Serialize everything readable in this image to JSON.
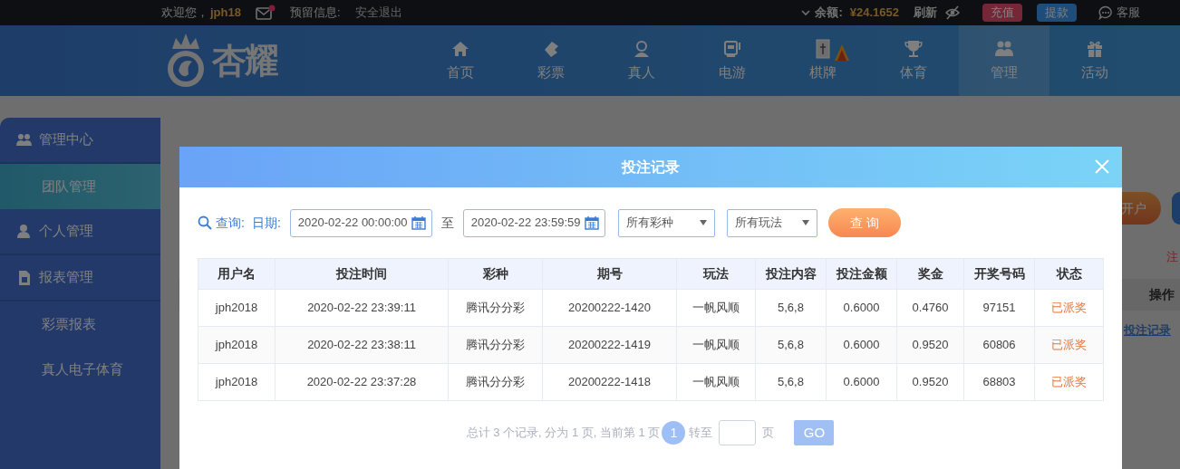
{
  "top_bar": {
    "greeting": "欢迎您，",
    "username": "jph18",
    "mail_unread": true,
    "reserved_info_label": "预留信息:",
    "logout": "安全退出",
    "balance_label": "余额:",
    "balance": "¥24.1652",
    "refresh": "刷新",
    "deposit": "充值",
    "withdraw": "提款",
    "support": "客服"
  },
  "logo": {
    "text": "杏耀"
  },
  "nav": [
    {
      "label": "首页",
      "selected": false,
      "hot": false
    },
    {
      "label": "彩票",
      "selected": false,
      "hot": false
    },
    {
      "label": "真人",
      "selected": false,
      "hot": false
    },
    {
      "label": "电游",
      "selected": false,
      "hot": false
    },
    {
      "label": "棋牌",
      "selected": false,
      "hot": true
    },
    {
      "label": "体育",
      "selected": false,
      "hot": false
    },
    {
      "label": "管理",
      "selected": true,
      "hot": false
    },
    {
      "label": "活动",
      "selected": false,
      "hot": false
    }
  ],
  "sidebar": [
    {
      "label": "管理中心",
      "children": [
        {
          "label": "团队管理",
          "selected": true
        }
      ]
    },
    {
      "label": "个人管理"
    },
    {
      "label": "报表管理",
      "children": [
        {
          "label": "彩票报表",
          "selected": false
        },
        {
          "label": "真人电子体育",
          "selected": false
        }
      ]
    }
  ],
  "page": {
    "open_account_button": "开户",
    "note": "注",
    "column_header": "操作",
    "row_link": "投注记录"
  },
  "modal": {
    "title": "投注记录",
    "filter": {
      "query_label": "查询:",
      "date_label": "日期:",
      "start_date": "2020-02-22 00:00:00",
      "to_label": "至",
      "end_date": "2020-02-22 23:59:59",
      "lottery_select": "所有彩种",
      "play_select": "所有玩法",
      "search_button": "查 询"
    },
    "table": {
      "columns": [
        "用户名",
        "投注时间",
        "彩种",
        "期号",
        "玩法",
        "投注内容",
        "投注金额",
        "奖金",
        "开奖号码",
        "状态"
      ],
      "rows": [
        [
          "jph2018",
          "2020-02-22 23:39:11",
          "腾讯分分彩",
          "20200222-1420",
          "一帆风顺",
          "5,6,8",
          "0.6000",
          "0.4760",
          "97151",
          "已派奖"
        ],
        [
          "jph2018",
          "2020-02-22 23:38:11",
          "腾讯分分彩",
          "20200222-1419",
          "一帆风顺",
          "5,6,8",
          "0.6000",
          "0.9520",
          "60806",
          "已派奖"
        ],
        [
          "jph2018",
          "2020-02-22 23:37:28",
          "腾讯分分彩",
          "20200222-1418",
          "一帆风顺",
          "5,6,8",
          "0.6000",
          "0.9520",
          "68803",
          "已派奖"
        ]
      ]
    },
    "pagination": {
      "summary": "总计 3 个记录, 分为 1 页, 当前第 1 页",
      "pages": [
        {
          "label": "1",
          "selected": true
        }
      ],
      "goto_label": "转至",
      "page_unit": "页",
      "go_button": "GO"
    }
  }
}
